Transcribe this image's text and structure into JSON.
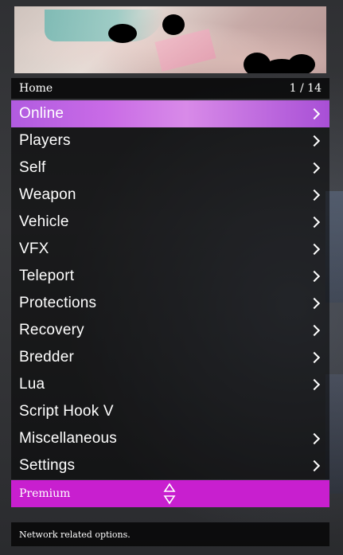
{
  "header": {
    "title": "Home",
    "position": "1 / 14"
  },
  "menu": {
    "items": [
      {
        "label": "Online",
        "has_submenu": true,
        "selected": true
      },
      {
        "label": "Players",
        "has_submenu": true
      },
      {
        "label": "Self",
        "has_submenu": true
      },
      {
        "label": "Weapon",
        "has_submenu": true
      },
      {
        "label": "Vehicle",
        "has_submenu": true
      },
      {
        "label": "VFX",
        "has_submenu": true
      },
      {
        "label": "Teleport",
        "has_submenu": true
      },
      {
        "label": "Protections",
        "has_submenu": true
      },
      {
        "label": "Recovery",
        "has_submenu": true
      },
      {
        "label": "Bredder",
        "has_submenu": true
      },
      {
        "label": "Lua",
        "has_submenu": true
      },
      {
        "label": "Script Hook V",
        "has_submenu": false
      },
      {
        "label": "Miscellaneous",
        "has_submenu": true
      },
      {
        "label": "Settings",
        "has_submenu": true
      }
    ]
  },
  "footer": {
    "label": "Premium",
    "scroll_icon": "up-down-arrows-icon"
  },
  "description": {
    "text": "Network related options."
  },
  "colors": {
    "selected_gradient_start": "#b15be0",
    "selected_gradient_end": "#a84fd6",
    "footer_accent": "#c81fcf",
    "item_background": "rgba(0,0,0,0.55)",
    "text": "#ffffff"
  }
}
